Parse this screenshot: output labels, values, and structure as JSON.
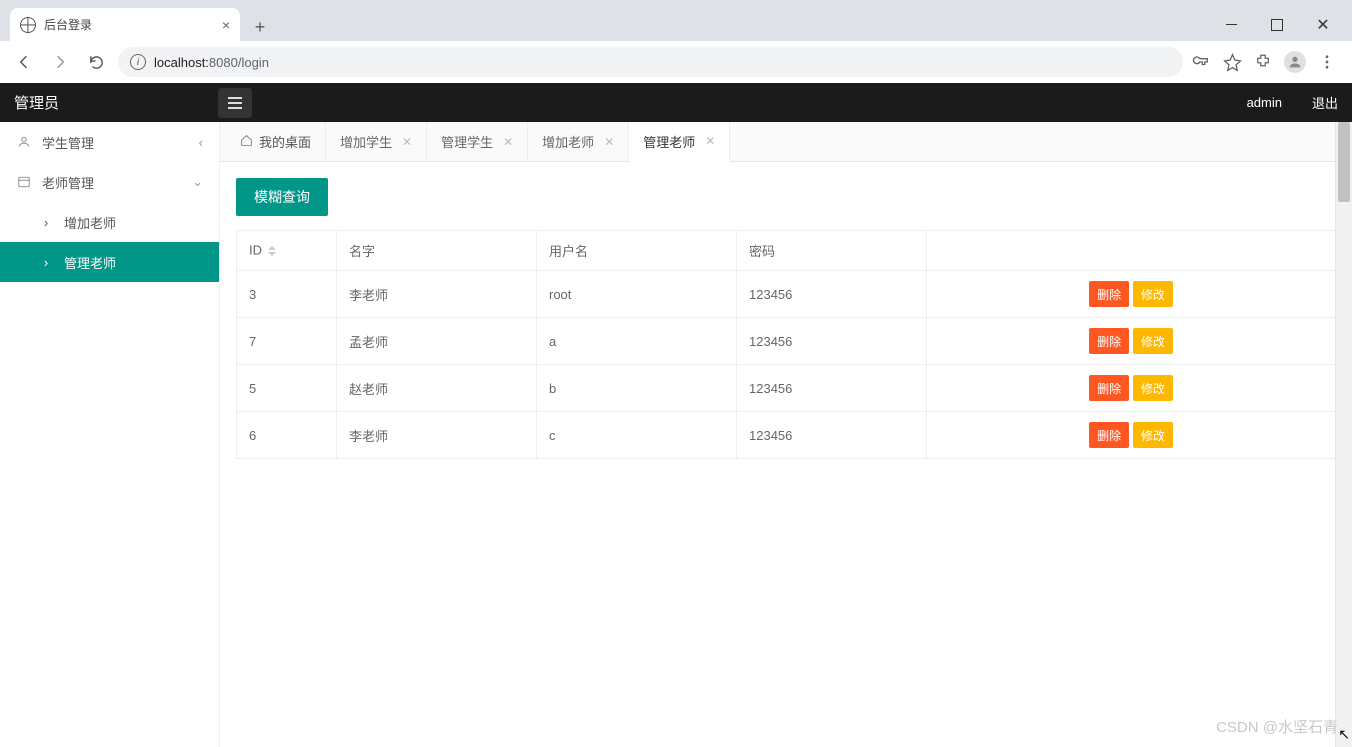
{
  "browser": {
    "tab_title": "后台登录",
    "url_host": "localhost:",
    "url_port": "8080",
    "url_path": "/login"
  },
  "header": {
    "title": "管理员",
    "user": "admin",
    "logout": "退出"
  },
  "sidebar": {
    "items": [
      {
        "label": "学生管理",
        "expanded": false
      },
      {
        "label": "老师管理",
        "expanded": true
      }
    ],
    "subitems": [
      {
        "label": "增加老师",
        "active": false
      },
      {
        "label": "管理老师",
        "active": true
      }
    ]
  },
  "content_tabs": [
    {
      "label": "我的桌面",
      "home": true,
      "closable": false,
      "active": false
    },
    {
      "label": "增加学生",
      "home": false,
      "closable": true,
      "active": false
    },
    {
      "label": "管理学生",
      "home": false,
      "closable": true,
      "active": false
    },
    {
      "label": "增加老师",
      "home": false,
      "closable": true,
      "active": false
    },
    {
      "label": "管理老师",
      "home": false,
      "closable": true,
      "active": true
    }
  ],
  "toolbar": {
    "fuzzy_search": "模糊查询"
  },
  "table": {
    "columns": [
      "ID",
      "名字",
      "用户名",
      "密码",
      ""
    ],
    "rows": [
      {
        "id": "3",
        "name": "李老师",
        "username": "root",
        "password": "123456"
      },
      {
        "id": "7",
        "name": "孟老师",
        "username": "a",
        "password": "123456"
      },
      {
        "id": "5",
        "name": "赵老师",
        "username": "b",
        "password": "123456"
      },
      {
        "id": "6",
        "name": "李老师",
        "username": "c",
        "password": "123456"
      }
    ],
    "actions": {
      "delete": "删除",
      "edit": "修改"
    }
  },
  "watermark": "CSDN @水坚石青"
}
